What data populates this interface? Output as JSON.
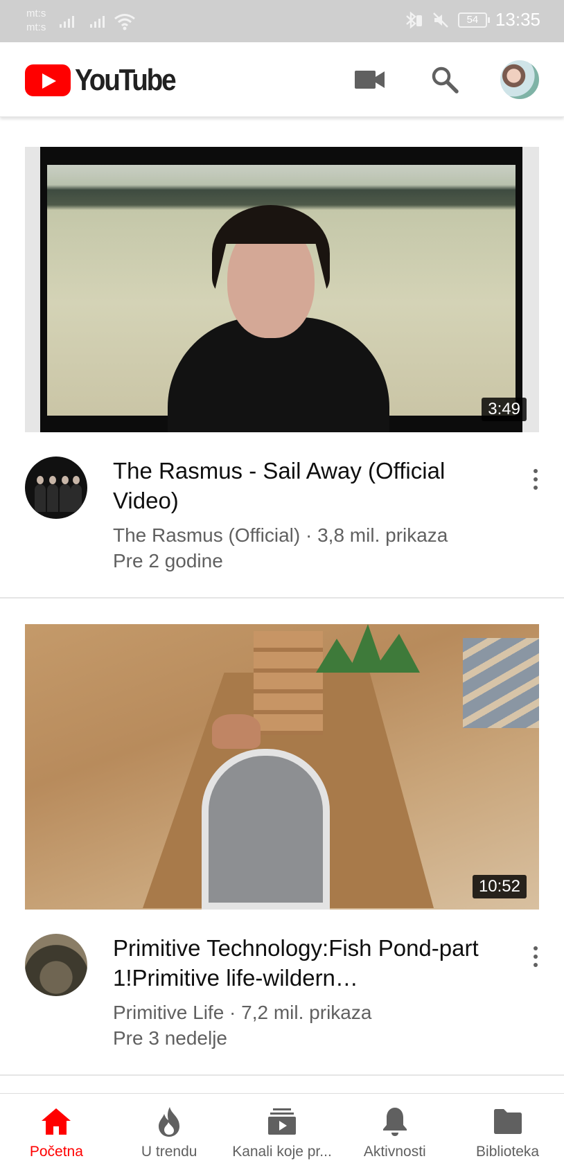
{
  "status_bar": {
    "carrier_1": "mt:s",
    "carrier_2": "mt:s",
    "battery": "54",
    "time": "13:35"
  },
  "header": {
    "logo_text": "YouTube",
    "brand_color": "#ff0000",
    "icons": [
      "video-camera-icon",
      "search-icon",
      "account-avatar"
    ]
  },
  "feed": [
    {
      "title": "The Rasmus - Sail Away (Official Video)",
      "channel": "The Rasmus (Official)",
      "views": "3,8 mil. prikaza",
      "meta": "The Rasmus (Official) · 3,8 mil. prikaza",
      "age": "Pre 2 godine",
      "duration": "3:49"
    },
    {
      "title": "Primitive Technology:Fish Pond-part 1!Primitive life-wildern…",
      "channel": "Primitive Life",
      "views": "7,2 mil. prikaza",
      "meta": "Primitive Life · 7,2 mil. prikaza",
      "age": "Pre 3 nedelje",
      "duration": "10:52"
    }
  ],
  "bottom_nav": {
    "active_color": "#ff0000",
    "items": [
      {
        "label": "Početna",
        "icon": "home-icon",
        "active": true
      },
      {
        "label": "U trendu",
        "icon": "flame-icon",
        "active": false
      },
      {
        "label": "Kanali koje pr...",
        "icon": "subscriptions-icon",
        "active": false
      },
      {
        "label": "Aktivnosti",
        "icon": "bell-icon",
        "active": false
      },
      {
        "label": "Biblioteka",
        "icon": "folder-icon",
        "active": false
      }
    ]
  }
}
